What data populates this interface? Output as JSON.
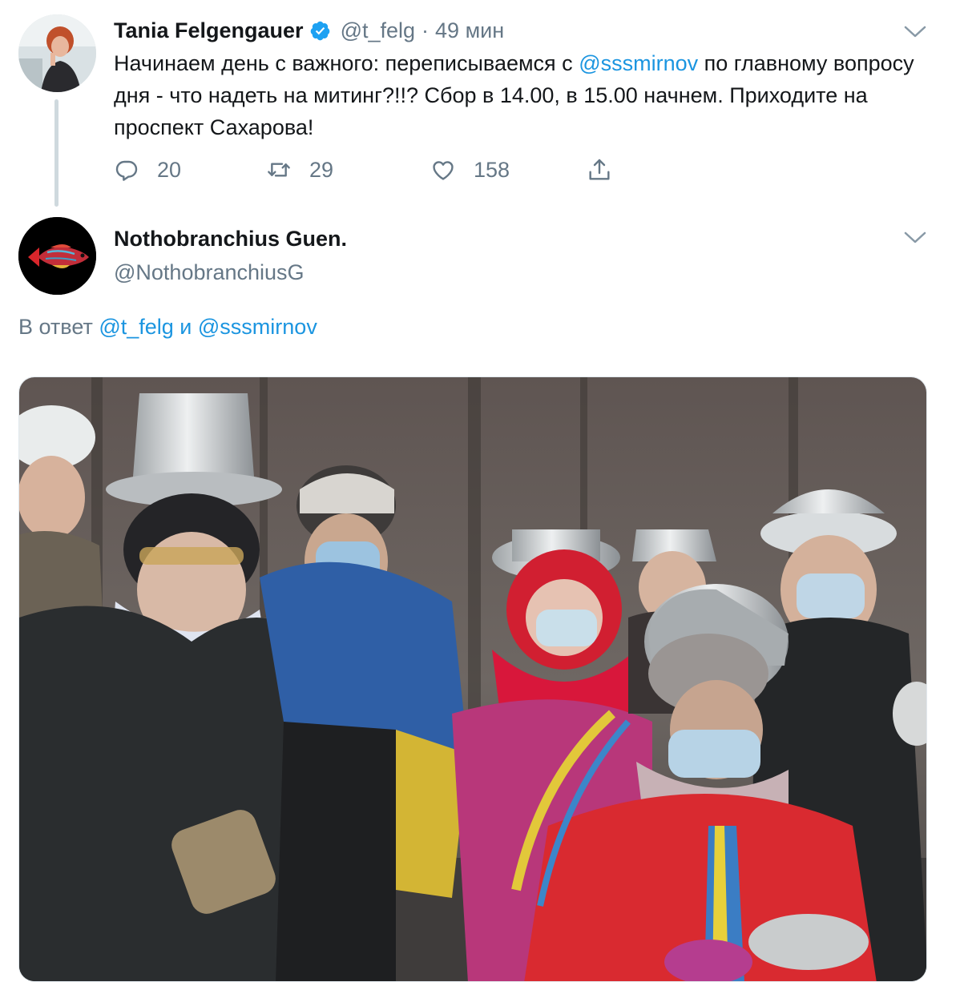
{
  "tweet1": {
    "author_name": "Tania Felgengauer",
    "handle": "@t_felg",
    "separator": "·",
    "time": "49 мин",
    "verified_icon": "verified-badge-icon",
    "text_part1": "Начинаем день с важного: переписываемся с ",
    "text_mention": "@sssmirnov",
    "text_part2": " по главному вопросу дня - что надеть на митинг?!!? Сбор в 14.00, в 15.00 начнем. Приходите на проспект Сахарова!",
    "replies": "20",
    "retweets": "29",
    "likes": "158",
    "colors": {
      "mention": "#1b95e0",
      "muted": "#657786",
      "thread_line": "#cfd9de"
    }
  },
  "tweet2": {
    "author_name": "Nothobranchius Guen.",
    "handle": "@NothobranchiusG",
    "reply_prefix": "В ответ ",
    "reply_mention1": "@t_felg",
    "reply_joiner": " и ",
    "reply_mention2": "@sssmirnov",
    "media_icon": "photo-protest-image"
  }
}
